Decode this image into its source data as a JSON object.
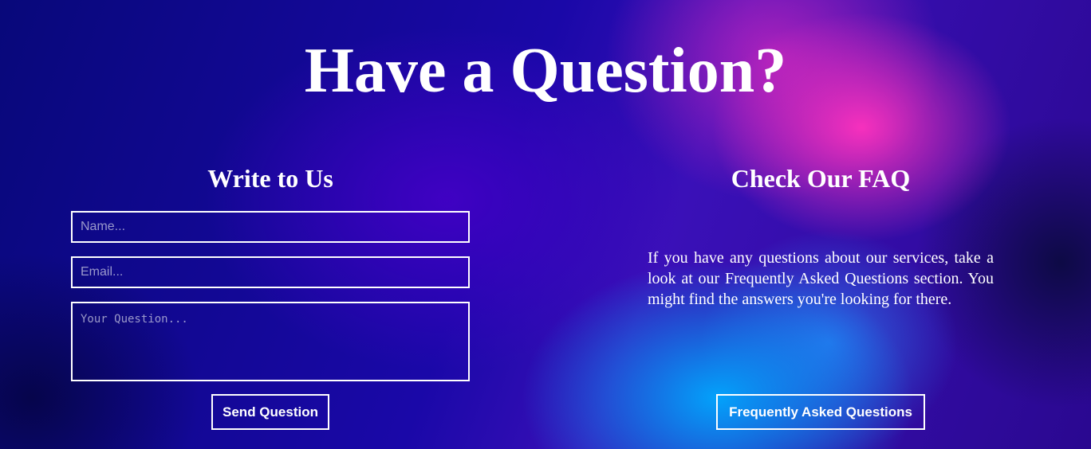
{
  "page": {
    "title": "Have a Question?"
  },
  "write_to_us": {
    "heading": "Write to Us",
    "name_placeholder": "Name...",
    "email_placeholder": "Email...",
    "question_placeholder": "Your Question...",
    "submit_label": "Send Question"
  },
  "faq": {
    "heading": "Check Our FAQ",
    "text": "If you have any questions about our services, take a look at our Frequently Asked Questions section. You might find the answers you're looking for there.",
    "button_label": "Frequently Asked Questions"
  },
  "colors": {
    "text": "#ffffff",
    "background_base": "#0a0a8a",
    "accent_pink": "#ff32be",
    "accent_cyan": "#00aaff"
  }
}
